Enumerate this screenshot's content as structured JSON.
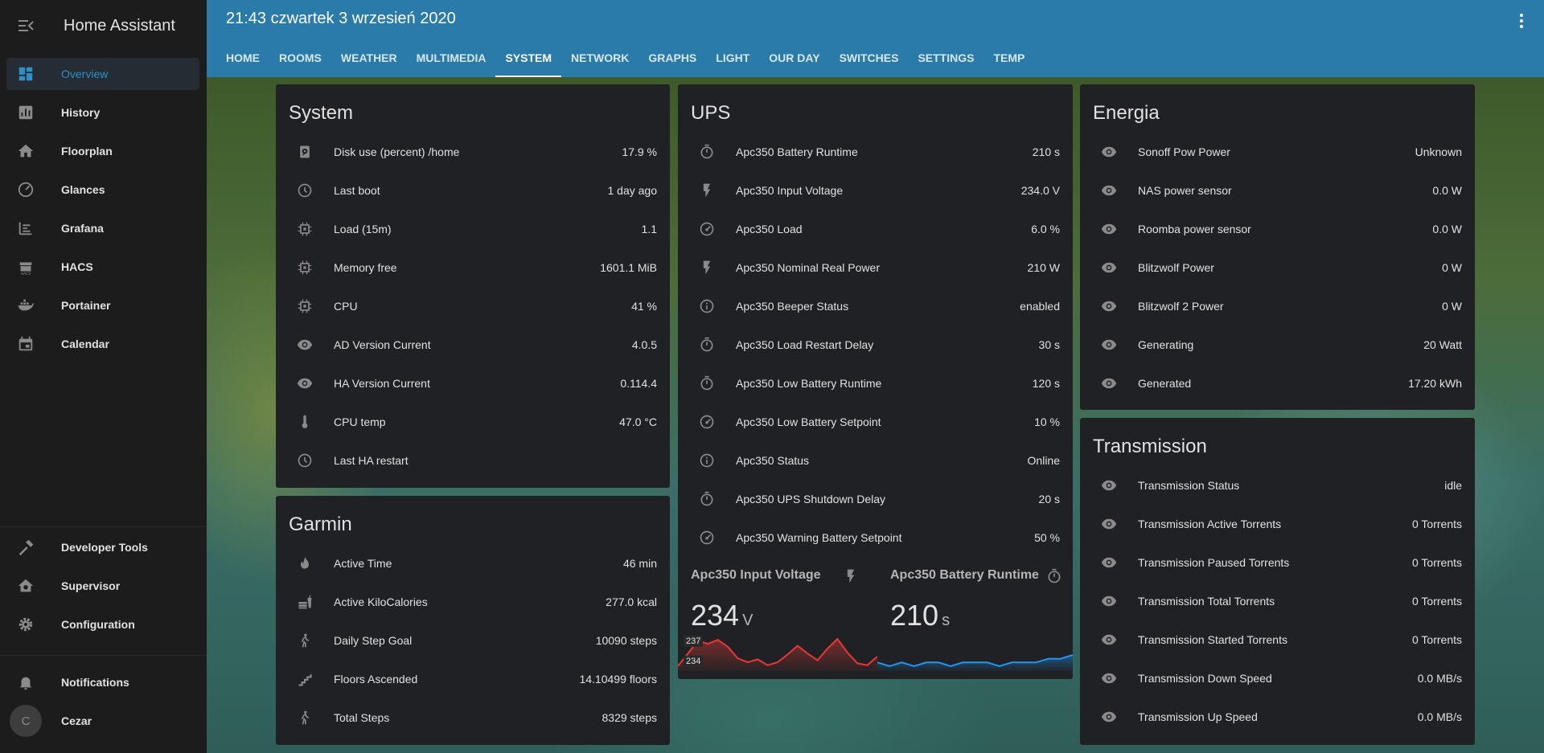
{
  "app": {
    "title": "Home Assistant"
  },
  "sidebar": {
    "items": [
      {
        "label": "Overview",
        "icon": "dashboard-icon"
      },
      {
        "label": "History",
        "icon": "chart-box-icon"
      },
      {
        "label": "Floorplan",
        "icon": "home-icon"
      },
      {
        "label": "Glances",
        "icon": "gauge-icon"
      },
      {
        "label": "Grafana",
        "icon": "grafana-icon"
      },
      {
        "label": "HACS",
        "icon": "hacs-icon"
      },
      {
        "label": "Portainer",
        "icon": "docker-icon"
      },
      {
        "label": "Calendar",
        "icon": "calendar-icon"
      }
    ],
    "bottom": [
      {
        "label": "Developer Tools",
        "icon": "hammer-icon"
      },
      {
        "label": "Supervisor",
        "icon": "supervisor-icon"
      },
      {
        "label": "Configuration",
        "icon": "gear-icon"
      }
    ],
    "notifications": "Notifications",
    "user": {
      "name": "Cezar",
      "initial": "C"
    }
  },
  "header": {
    "title": "21:43 czwartek 3 wrzesień 2020",
    "tabs": [
      "HOME",
      "ROOMS",
      "WEATHER",
      "MULTIMEDIA",
      "SYSTEM",
      "NETWORK",
      "GRAPHS",
      "LIGHT",
      "OUR DAY",
      "SWITCHES",
      "SETTINGS",
      "TEMP"
    ],
    "active_tab": "SYSTEM"
  },
  "system": {
    "title": "System",
    "rows": [
      {
        "name": "Disk use (percent) /home",
        "value": "17.9 %",
        "icon": "harddisk-icon"
      },
      {
        "name": "Last boot",
        "value": "1 day ago",
        "icon": "clock-icon"
      },
      {
        "name": "Load (15m)",
        "value": "1.1",
        "icon": "chip-icon"
      },
      {
        "name": "Memory free",
        "value": "1601.1 MiB",
        "icon": "chip-icon"
      },
      {
        "name": "CPU",
        "value": "41 %",
        "icon": "chip-icon"
      },
      {
        "name": "AD Version Current",
        "value": "4.0.5",
        "icon": "eye-icon"
      },
      {
        "name": "HA Version Current",
        "value": "0.114.4",
        "icon": "eye-icon"
      },
      {
        "name": "CPU temp",
        "value": "47.0 °C",
        "icon": "thermometer-icon"
      },
      {
        "name": "Last HA restart",
        "value": "",
        "icon": "clock-icon"
      }
    ]
  },
  "garmin": {
    "title": "Garmin",
    "rows": [
      {
        "name": "Active Time",
        "value": "46 min",
        "icon": "fire-icon"
      },
      {
        "name": "Active KiloCalories",
        "value": "277.0 kcal",
        "icon": "food-icon"
      },
      {
        "name": "Daily Step Goal",
        "value": "10090 steps",
        "icon": "walk-icon"
      },
      {
        "name": "Floors Ascended",
        "value": "14.10499 floors",
        "icon": "stairs-icon"
      },
      {
        "name": "Total Steps",
        "value": "8329 steps",
        "icon": "walk-icon"
      }
    ]
  },
  "ups": {
    "title": "UPS",
    "rows": [
      {
        "name": "Apc350 Battery Runtime",
        "value": "210 s",
        "icon": "timer-icon"
      },
      {
        "name": "Apc350 Input Voltage",
        "value": "234.0 V",
        "icon": "flash-icon"
      },
      {
        "name": "Apc350 Load",
        "value": "6.0 %",
        "icon": "gauge-icon"
      },
      {
        "name": "Apc350 Nominal Real Power",
        "value": "210 W",
        "icon": "flash-icon"
      },
      {
        "name": "Apc350 Beeper Status",
        "value": "enabled",
        "icon": "info-icon"
      },
      {
        "name": "Apc350 Load Restart Delay",
        "value": "30 s",
        "icon": "timer-icon"
      },
      {
        "name": "Apc350 Low Battery Runtime",
        "value": "120 s",
        "icon": "timer-icon"
      },
      {
        "name": "Apc350 Low Battery Setpoint",
        "value": "10 %",
        "icon": "gauge-icon"
      },
      {
        "name": "Apc350 Status",
        "value": "Online",
        "icon": "info-icon"
      },
      {
        "name": "Apc350 UPS Shutdown Delay",
        "value": "20 s",
        "icon": "timer-icon"
      },
      {
        "name": "Apc350 Warning Battery Setpoint",
        "value": "50 %",
        "icon": "gauge-icon"
      }
    ],
    "sensors": [
      {
        "name": "Apc350 Input Voltage",
        "value": "234",
        "unit": "V",
        "icon": "flash-icon",
        "color": "#e53935",
        "ymin_label": "234",
        "ymax_label": "237",
        "series": [
          234.2,
          235.5,
          236.8,
          236.5,
          236.9,
          236.2,
          235.0,
          234.6,
          234.9,
          234.3,
          234.6,
          235.4,
          236.3,
          235.5,
          234.8,
          236.0,
          237.0,
          235.6,
          234.5,
          234.3,
          235.2
        ]
      },
      {
        "name": "Apc350 Battery Runtime",
        "value": "210",
        "unit": "s",
        "icon": "timer-icon",
        "color": "#2196f3",
        "series": [
          210.9,
          210.8,
          210.9,
          210.8,
          210.9,
          210.9,
          210.8,
          210.9,
          210.9,
          210.9,
          210.8,
          210.9,
          210.9,
          210.9,
          211.0,
          211.0,
          211.1
        ]
      }
    ]
  },
  "energia": {
    "title": "Energia",
    "rows": [
      {
        "name": "Sonoff Pow Power",
        "value": "Unknown",
        "icon": "eye-icon"
      },
      {
        "name": "NAS power sensor",
        "value": "0.0 W",
        "icon": "eye-icon"
      },
      {
        "name": "Roomba power sensor",
        "value": "0.0 W",
        "icon": "eye-icon"
      },
      {
        "name": "Blitzwolf Power",
        "value": "0 W",
        "icon": "eye-icon"
      },
      {
        "name": "Blitzwolf 2 Power",
        "value": "0 W",
        "icon": "eye-icon"
      },
      {
        "name": "Generating",
        "value": "20 Watt",
        "icon": "eye-icon"
      },
      {
        "name": "Generated",
        "value": "17.20 kWh",
        "icon": "eye-icon"
      }
    ]
  },
  "transmission": {
    "title": "Transmission",
    "rows": [
      {
        "name": "Transmission Status",
        "value": "idle",
        "icon": "eye-icon"
      },
      {
        "name": "Transmission Active Torrents",
        "value": "0 Torrents",
        "icon": "eye-icon"
      },
      {
        "name": "Transmission Paused Torrents",
        "value": "0 Torrents",
        "icon": "eye-icon"
      },
      {
        "name": "Transmission Total Torrents",
        "value": "0 Torrents",
        "icon": "eye-icon"
      },
      {
        "name": "Transmission Started Torrents",
        "value": "0 Torrents",
        "icon": "eye-icon"
      },
      {
        "name": "Transmission Down Speed",
        "value": "0.0 MB/s",
        "icon": "eye-icon"
      },
      {
        "name": "Transmission Up Speed",
        "value": "0.0 MB/s",
        "icon": "eye-icon"
      }
    ]
  }
}
